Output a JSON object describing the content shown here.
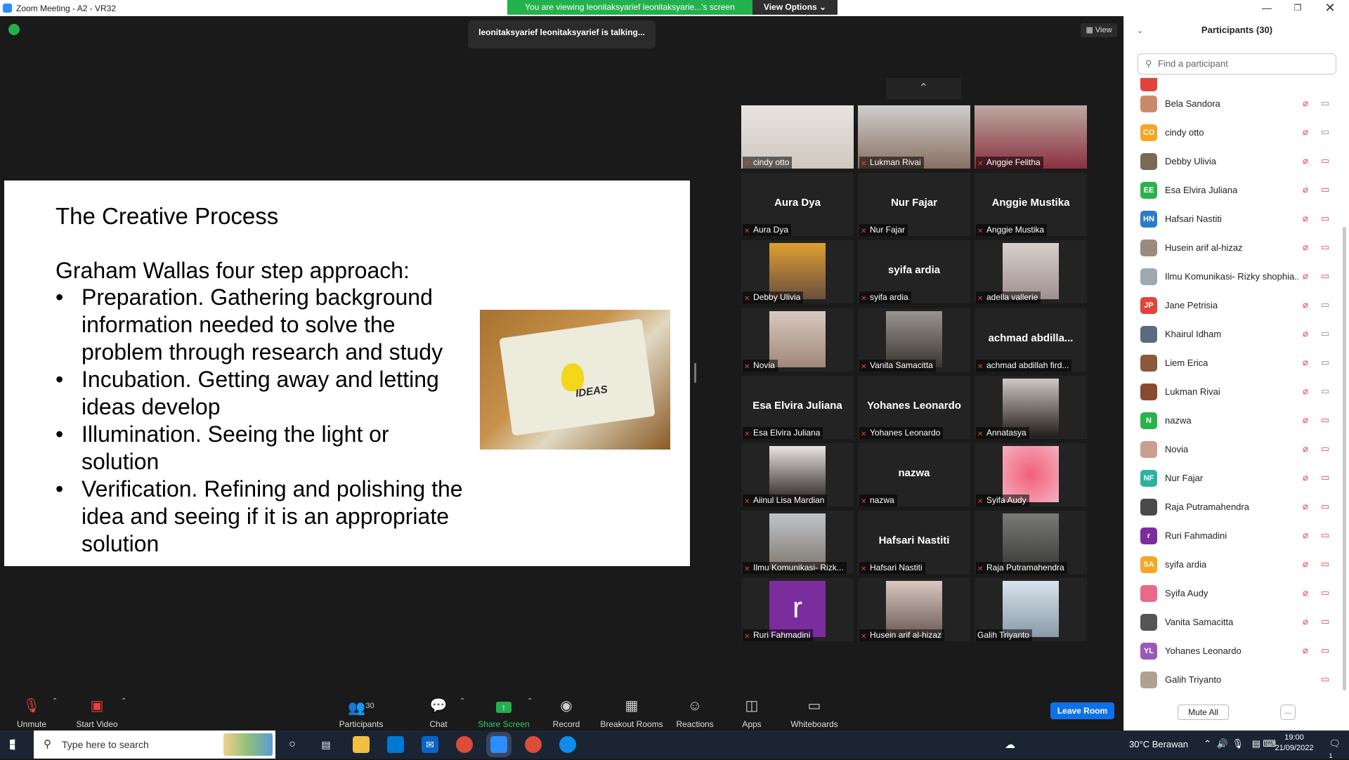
{
  "window": {
    "title": "Zoom Meeting - A2 - VR32"
  },
  "banner": {
    "viewing_text": "You are viewing leonitaksyarief leonitaksyarie...'s screen",
    "view_options": "View Options ⌄"
  },
  "talking": "leonitaksyarief leonitaksyarief is talking...",
  "view_button": "View",
  "slide": {
    "title": "The Creative Process",
    "subtitle": "Graham Wallas four step approach:",
    "bullets": [
      "Preparation. Gathering background information needed to solve the problem through research and study",
      "Incubation. Getting away and letting ideas develop",
      "Illumination. Seeing the light or solution",
      "Verification. Refining and polishing the idea and seeing if it is an appropriate solution"
    ],
    "image_text": "IDEAS"
  },
  "tiles": [
    {
      "label": "cindy otto",
      "big": ""
    },
    {
      "label": "Lukman Rivai",
      "big": ""
    },
    {
      "label": "Anggie Felitha",
      "big": ""
    },
    {
      "label": "Aura Dya",
      "big": "Aura Dya"
    },
    {
      "label": "Nur Fajar",
      "big": "Nur Fajar"
    },
    {
      "label": "Anggie Mustika",
      "big": "Anggie Mustika"
    },
    {
      "label": "Debby Ulivia",
      "big": ""
    },
    {
      "label": "syifa ardia",
      "big": "syifa ardia"
    },
    {
      "label": "adella vallerie",
      "big": ""
    },
    {
      "label": "Novia",
      "big": ""
    },
    {
      "label": "Vanita Samacitta",
      "big": ""
    },
    {
      "label": "achmad abdillah fird...",
      "big": "achmad  abdilla..."
    },
    {
      "label": "Esa Elvira Juliana",
      "big": "Esa Elvira Juliana"
    },
    {
      "label": "Yohanes Leonardo",
      "big": "Yohanes Leonardo"
    },
    {
      "label": "Annatasya",
      "big": ""
    },
    {
      "label": "Aiinul Lisa Mardian",
      "big": ""
    },
    {
      "label": "nazwa",
      "big": "nazwa"
    },
    {
      "label": "Syifa Audy",
      "big": ""
    },
    {
      "label": "Ilmu Komunikasi- Rizk...",
      "big": ""
    },
    {
      "label": "Hafsari Nastiti",
      "big": "Hafsari Nastiti"
    },
    {
      "label": "Raja Putramahendra",
      "big": ""
    },
    {
      "label": "Ruri Fahmadini",
      "big": "",
      "letter": "r"
    },
    {
      "label": "Husein arif al-hizaz",
      "big": ""
    },
    {
      "label": "Galih Triyanto",
      "big": ""
    }
  ],
  "panel": {
    "title": "Participants (30)",
    "search_placeholder": "Find a participant",
    "participants": [
      {
        "name": "Bela Sandora",
        "initials": "",
        "color": "#c98a6a",
        "cam": "on"
      },
      {
        "name": "cindy otto",
        "initials": "CO",
        "color": "#f5a623",
        "cam": "on"
      },
      {
        "name": "Debby Ulivia",
        "initials": "",
        "color": "#7a6a55",
        "cam": "off"
      },
      {
        "name": "Esa Elvira Juliana",
        "initials": "EE",
        "color": "#2bb24c",
        "cam": "off"
      },
      {
        "name": "Hafsari Nastiti",
        "initials": "HN",
        "color": "#2d7cc7",
        "cam": "off"
      },
      {
        "name": "Husein arif al-hizaz",
        "initials": "",
        "color": "#9a8a80",
        "cam": "off"
      },
      {
        "name": "Ilmu Komunikasi- Rizky shophia...",
        "initials": "",
        "color": "#a0a8b0",
        "cam": "off"
      },
      {
        "name": "Jane Petrisia",
        "initials": "JP",
        "color": "#e0443a",
        "cam": "on"
      },
      {
        "name": "Khairul Idham",
        "initials": "",
        "color": "#5a6a80",
        "cam": "on"
      },
      {
        "name": "Liem Erica",
        "initials": "",
        "color": "#8a5a3a",
        "cam": "on"
      },
      {
        "name": "Lukman Rivai",
        "initials": "",
        "color": "#8a4a30",
        "cam": "on"
      },
      {
        "name": "nazwa",
        "initials": "N",
        "color": "#2bb24c",
        "cam": "off"
      },
      {
        "name": "Novia",
        "initials": "",
        "color": "#c9a090",
        "cam": "off"
      },
      {
        "name": "Nur Fajar",
        "initials": "NF",
        "color": "#2bb2a0",
        "cam": "off"
      },
      {
        "name": "Raja Putramahendra",
        "initials": "",
        "color": "#4a4a4a",
        "cam": "off"
      },
      {
        "name": "Ruri Fahmadini",
        "initials": "r",
        "color": "#7b2d9e",
        "cam": "off"
      },
      {
        "name": "syifa ardia",
        "initials": "SA",
        "color": "#f5a623",
        "cam": "off"
      },
      {
        "name": "Syifa Audy",
        "initials": "",
        "color": "#e86a8a",
        "cam": "off"
      },
      {
        "name": "Vanita Samacitta",
        "initials": "",
        "color": "#555555",
        "cam": "off"
      },
      {
        "name": "Yohanes Leonardo",
        "initials": "YL",
        "color": "#9b59b6",
        "cam": "off"
      },
      {
        "name": "Galih Triyanto",
        "initials": "",
        "color": "#b0a090",
        "cam": "off"
      }
    ],
    "mute_all": "Mute All",
    "more": "..."
  },
  "toolbar": {
    "unmute": "Unmute",
    "start_video": "Start Video",
    "participants": "Participants",
    "participants_count": "30",
    "chat": "Chat",
    "share_screen": "Share Screen",
    "record": "Record",
    "breakout": "Breakout Rooms",
    "reactions": "Reactions",
    "apps": "Apps",
    "whiteboards": "Whiteboards",
    "leave": "Leave Room"
  },
  "taskbar": {
    "search_placeholder": "Type here to search",
    "weather": "30°C  Berawan",
    "time": "19:00",
    "date": "21/09/2022",
    "notifications": "1"
  },
  "colors": {
    "accent": "#0e71eb",
    "share": "#23b14d",
    "muted": "#e84040"
  }
}
